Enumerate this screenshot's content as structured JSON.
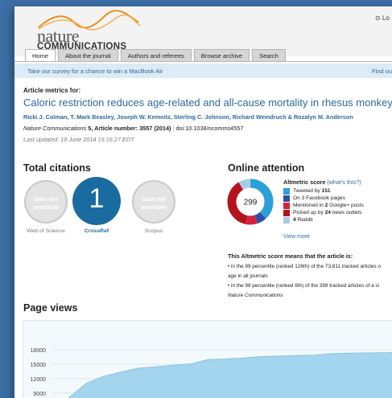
{
  "header": {
    "logo_top": "nature",
    "logo_bottom": "COMMUNICATIONS",
    "login": "⊙ Lo"
  },
  "tabs": [
    {
      "label": "Home"
    },
    {
      "label": "About the journal"
    },
    {
      "label": "Authors and referees"
    },
    {
      "label": "Browse archive"
    },
    {
      "label": "Search"
    }
  ],
  "survey": {
    "text": "Take our survey for a chance to win a MacBook Air",
    "find": "Find ou"
  },
  "article": {
    "metrics_for": "Article metrics for:",
    "title": "Caloric restriction reduces age-related and all-cause mortality in rhesus monkeys",
    "authors": "Ricki J. Colman, T. Mark Beasley, Joseph W. Kemnitz, Sterling C. Johnson, Richard Weindruch & Rozalyn M. Anderson",
    "journal": "Nature Communications",
    "journal_detail": " 5, Article number: 3557 (2014)",
    "doi": "doi:10.1038/ncomms4557",
    "updated": "Last updated: 19 June 2014 15:16:27 EDT"
  },
  "citations": {
    "heading": "Total citations",
    "items": [
      {
        "label": "Web of Science",
        "line1": "Data not",
        "line2": "available"
      },
      {
        "label": "CrossRef",
        "value": "1"
      },
      {
        "label": "Scopus",
        "line1": "Data not",
        "line2": "available"
      }
    ]
  },
  "attention": {
    "heading": "Online attention",
    "score": "299",
    "score_label": "Altmetric score",
    "whats_this": "(what's this?)",
    "legend": [
      {
        "pre": "Tweeted by ",
        "num": "151",
        "post": "",
        "color": "#2a9fd8"
      },
      {
        "pre": "On ",
        "num": "",
        "post": "3 Facebook pages",
        "color": "#2f4fa0"
      },
      {
        "pre": "Mentioned in ",
        "num": "2",
        "post": " Google+ posts",
        "color": "#d4233d"
      },
      {
        "pre": "Picked up by ",
        "num": "24",
        "post": " news outlets",
        "color": "#b5131c"
      },
      {
        "pre": "",
        "num": "4",
        "post": " Reddit",
        "color": "#a9cbe8"
      }
    ],
    "view_more": "View more",
    "means_heading": "This Altmetric score means that the article is:",
    "pct1_line1": "• in the 99 percentile (ranked 126th) of the 73,811 tracked articles o",
    "pct1_line2": "age in all journals",
    "pct2_line1": "• in the 98 percentile (ranked 6th) of the 399 tracked articles of a si",
    "pct2_line2": "Nature Communications"
  },
  "pageviews": {
    "heading": "Page views"
  },
  "chart_data": {
    "type": "area",
    "title": "",
    "xlabel": "",
    "ylabel": "",
    "y_ticks": [
      "18000",
      "15000",
      "12000",
      "9000"
    ],
    "ylim": [
      8000,
      20200
    ],
    "series": [
      {
        "values": [
          8000,
          11000,
          12500,
          13400,
          14200,
          14500,
          14800,
          15100,
          16000,
          16100,
          16300,
          16600,
          16700,
          16800,
          16900,
          17200,
          17300,
          17350,
          17400,
          17450
        ]
      }
    ],
    "color": "#a3d5ee"
  }
}
